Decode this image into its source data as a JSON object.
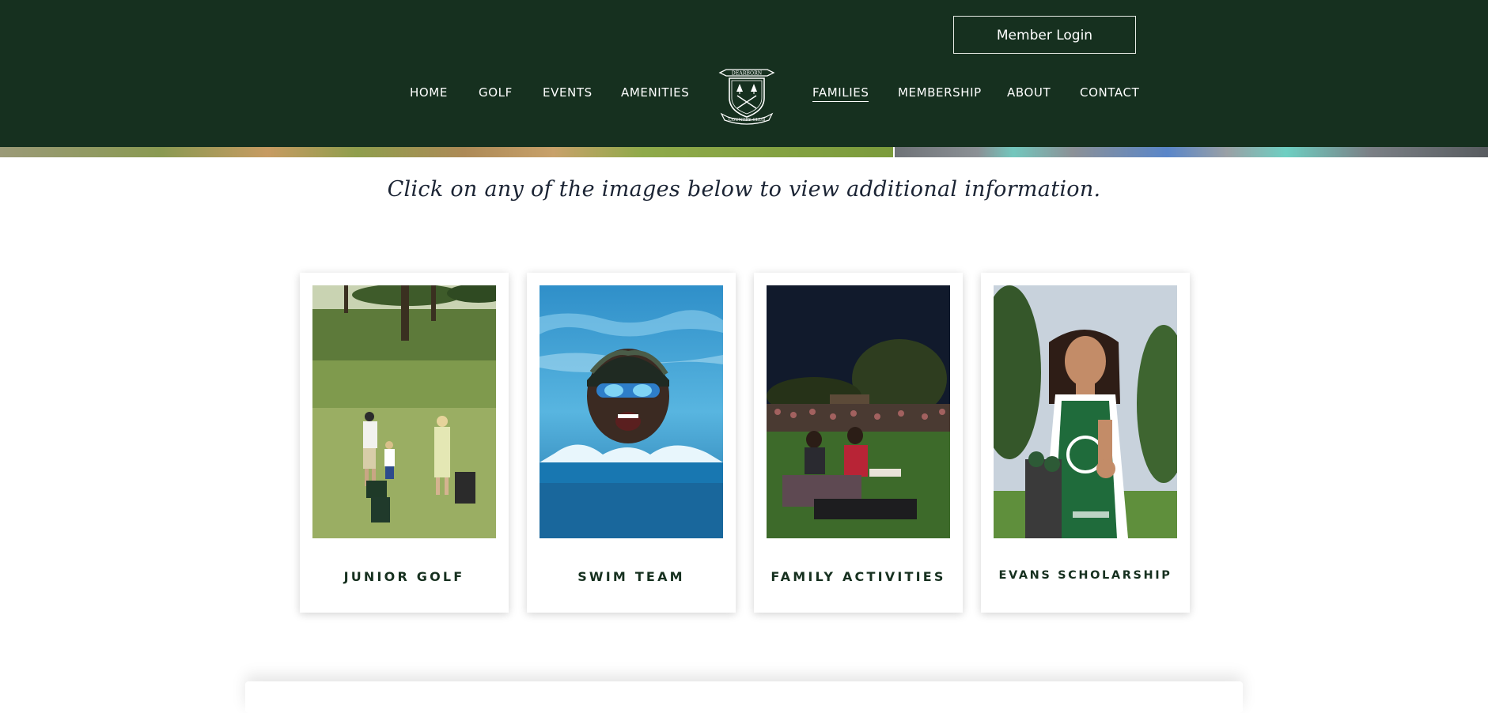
{
  "header": {
    "member_login_label": "Member Login",
    "logo_top_text": "DEARBORN",
    "logo_bottom_text": "COUNTRY CLUB",
    "nav_left": [
      "HOME",
      "GOLF",
      "EVENTS",
      "AMENITIES"
    ],
    "nav_right": [
      "FAMILIES",
      "MEMBERSHIP",
      "ABOUT",
      "CONTACT"
    ],
    "active_nav": "FAMILIES"
  },
  "main": {
    "instruction": "Click on any of the images below to view additional information."
  },
  "cards": [
    {
      "title": "JUNIOR GOLF",
      "image_icon": "junior-golf-photo"
    },
    {
      "title": "SWIM TEAM",
      "image_icon": "swim-team-photo"
    },
    {
      "title": "FAMILY ACTIVITIES",
      "image_icon": "family-activities-photo"
    },
    {
      "title": "EVANS SCHOLARSHIP",
      "image_icon": "evans-scholarship-photo"
    }
  ],
  "colors": {
    "header_bg": "#16301f",
    "text_dark": "#16301f",
    "script_text": "#1b2434"
  }
}
